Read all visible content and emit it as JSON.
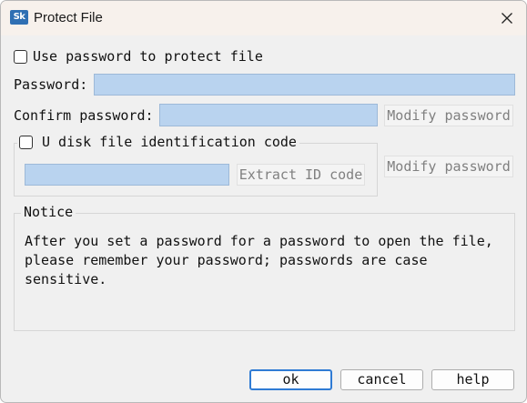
{
  "window": {
    "title": "Protect File",
    "app_icon": "Sk"
  },
  "protect": {
    "checkbox_label": "Use password to protect file"
  },
  "password": {
    "label": "Password:",
    "value": ""
  },
  "confirm": {
    "label": "Confirm password:",
    "value": "",
    "modify_label": "Modify password"
  },
  "udisk": {
    "checkbox_label": "U disk file identification code",
    "value": "",
    "extract_label": "Extract ID code",
    "modify_label": "Modify password"
  },
  "notice": {
    "title": "Notice",
    "text": "After you set a password for a password to open the file, please remember your password; passwords are case sensitive."
  },
  "buttons": {
    "ok": "ok",
    "cancel": "cancel",
    "help": "help"
  },
  "colors": {
    "input_fill": "#b9d3ef",
    "primary_border": "#2f7bd4",
    "disabled_text": "#808080"
  }
}
